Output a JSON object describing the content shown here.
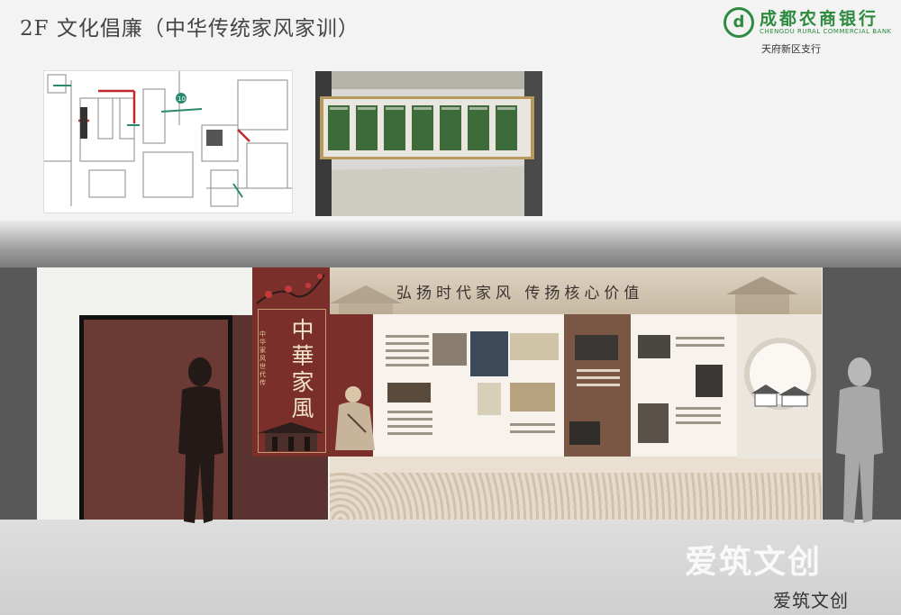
{
  "header": {
    "title": "2F 文化倡廉（中华传统家风家训）"
  },
  "logo": {
    "mark": "d",
    "name": "成都农商银行",
    "english": "CHENGDU RURAL COMMERCIAL BANK",
    "branch": "天府新区支行"
  },
  "floorplan": {
    "marker": "10"
  },
  "wall_display": {
    "slogan": "弘扬时代家风 传扬核心价值",
    "banner_big": "中華家風",
    "banner_small": "中华家风世代传"
  },
  "watermark": {
    "large": "爱筑文创",
    "small": "爱筑文创"
  },
  "colors": {
    "accent_red": "#7a2f2b",
    "brand_green": "#2d8a3e",
    "wall_grey": "#585858"
  }
}
